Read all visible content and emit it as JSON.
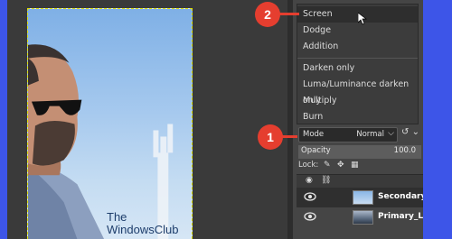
{
  "blend_mode_menu": {
    "items": [
      "Screen",
      "Dodge",
      "Addition",
      "Darken only",
      "Luma/Luminance darken only",
      "Multiply",
      "Burn"
    ],
    "selected": "Screen"
  },
  "layers_panel": {
    "mode_label": "Mode",
    "mode_value": "Normal",
    "opacity_label": "Opacity",
    "opacity_value": "100.0",
    "lock_label": "Lock:",
    "layers": [
      {
        "name": "Secondary_La",
        "selected": true
      },
      {
        "name": "Primary_Layer",
        "selected": false
      }
    ]
  },
  "watermark": {
    "line1": "The",
    "line2": "WindowsClub"
  },
  "callouts": [
    "1",
    "2"
  ],
  "colors": {
    "background_border": "#3d55e8",
    "badge": "#e53e2f"
  },
  "icons": {
    "visibility": "eye-icon",
    "chain": "chain-icon",
    "lock_paint": "brush-icon",
    "lock_position": "move-icon",
    "lock_alpha": "checker-icon"
  }
}
